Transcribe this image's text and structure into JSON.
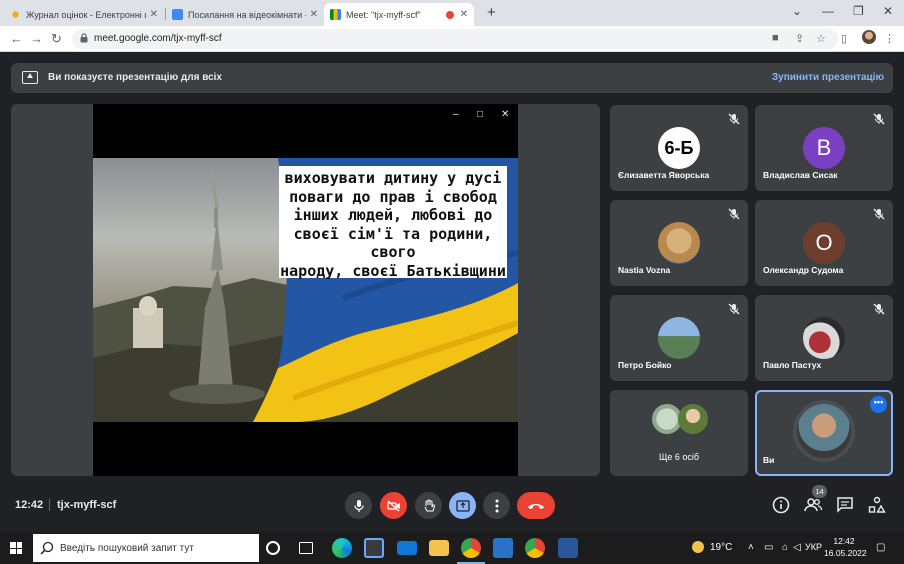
{
  "browser": {
    "tabs": [
      {
        "title": "Журнал оцінок - Електронні щ",
        "icon": "sun-favicon",
        "active": false
      },
      {
        "title": "Посилання на відеокімнати - G",
        "icon": "docs-favicon",
        "active": false
      },
      {
        "title": "Meet: \"tjx-myff-scf\"",
        "icon": "meet-favicon",
        "active": true
      }
    ],
    "url": "meet.google.com/tjx-myff-scf"
  },
  "banner": {
    "message": "Ви показуєте презентацію для всіх",
    "stop_label": "Зупинити презентацію"
  },
  "slide": {
    "lines": [
      "виховувати дитину у дусі",
      "поваги до прав і свобод",
      "інших людей, любові до",
      "своєї сім'ї та родини, свого",
      "народу, своєї Батьківщини"
    ]
  },
  "participants": [
    {
      "name": "Єлизаветта Яворська",
      "avatar_text": "6-Б",
      "avatar_color": "#ffffff",
      "avatar_text_color": "#000000",
      "muted": true
    },
    {
      "name": "Владислав Сисак",
      "avatar_text": "В",
      "avatar_color": "#7b3fc4",
      "avatar_text_color": "#ffffff",
      "muted": true
    },
    {
      "name": "Nastia Vozna",
      "avatar_text": "",
      "avatar_color": "#c9a262",
      "muted": true
    },
    {
      "name": "Олександр Судома",
      "avatar_text": "О",
      "avatar_color": "#6d3e2e",
      "avatar_text_color": "#ffffff",
      "muted": true
    },
    {
      "name": "Петро Бойко",
      "avatar_text": "",
      "avatar_color": "#6c93c4",
      "muted": true
    },
    {
      "name": "Павло Пастух",
      "avatar_text": "",
      "avatar_color": "#b0303a",
      "muted": true
    }
  ],
  "more_tile": {
    "label": "Ще 6 осіб"
  },
  "self_tile": {
    "name": "Ви"
  },
  "meeting": {
    "time": "12:42",
    "code": "tjx-myff-scf",
    "participant_count": "14"
  },
  "taskbar": {
    "search_placeholder": "Введіть пошуковий запит тут",
    "weather": "19°C",
    "language": "УКР",
    "clock_time": "12:42",
    "clock_date": "16.05.2022"
  }
}
